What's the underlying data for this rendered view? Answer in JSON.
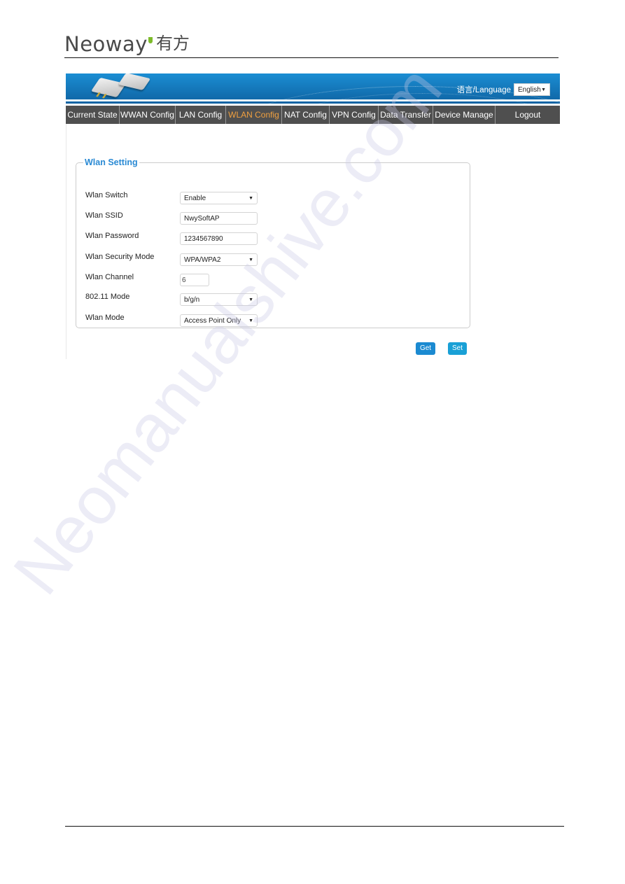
{
  "document": {
    "logo_text": "Neoway",
    "logo_cn": "有方",
    "logo_accent_color": "#7dbb2a",
    "watermark": "Neomanualshive.com"
  },
  "banner": {
    "language_label": "语言/Language",
    "language_selected": "English"
  },
  "nav": {
    "items": [
      {
        "label": "Current State"
      },
      {
        "label": "WWAN Config"
      },
      {
        "label": "LAN Config"
      },
      {
        "label": "WLAN Config",
        "active": true
      },
      {
        "label": "NAT Config"
      },
      {
        "label": "VPN Config"
      },
      {
        "label": "Data Transfer"
      },
      {
        "label": "Device Manage"
      },
      {
        "label": "Logout"
      }
    ],
    "active_color": "#f0a040"
  },
  "wlan": {
    "legend": "Wlan Setting",
    "fields": {
      "switch": {
        "label": "Wlan Switch",
        "value": "Enable"
      },
      "ssid": {
        "label": "Wlan SSID",
        "value": "NwySoftAP"
      },
      "password": {
        "label": "Wlan Password",
        "value": "1234567890"
      },
      "security": {
        "label": "Wlan Security Mode",
        "value": "WPA/WPA2"
      },
      "channel": {
        "label": "Wlan Channel",
        "value": "6"
      },
      "mode80211": {
        "label": "802.11 Mode",
        "value": "b/g/n"
      },
      "wlan_mode": {
        "label": "Wlan Mode",
        "value": "Access Point Only"
      }
    }
  },
  "buttons": {
    "get": "Get",
    "set": "Set"
  }
}
